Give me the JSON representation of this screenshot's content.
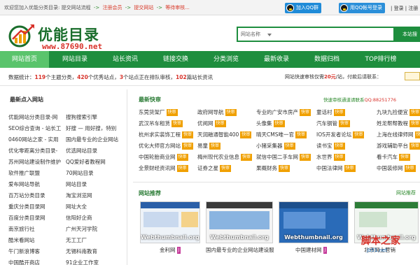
{
  "topbar": {
    "crumbs": [
      "欢迎您加入优能分类目录:",
      "提交网站流程",
      "注册会员",
      "提交网站",
      "等待审核..."
    ],
    "separator": "->",
    "qq_join": "加入QQ群",
    "qq_login": "用QQ帐号登录",
    "user_links": "| 登录 | 注册 |"
  },
  "logo": {
    "title": "优能目录",
    "url": "www.87690.net"
  },
  "search": {
    "category": "网站名称",
    "button": "本站搜"
  },
  "nav": {
    "items": [
      "网站首页",
      "网站目录",
      "站长资讯",
      "链接交换",
      "分类浏览",
      "最新收录",
      "数据归档",
      "TOP排行榜"
    ]
  },
  "stats": {
    "prefix": "数据统计：",
    "categories": "119",
    "categories_label": "个主题分类，",
    "sites": "420",
    "sites_label": "个优秀站点，",
    "pending": "3",
    "pending_label": "个站点正在排队审核，",
    "articles": "102",
    "articles_label": "篇站长资讯",
    "fast_prefix": "网站快速审核仅需",
    "fast_price": "20元",
    "fast_suffix": "/站，付款后请联系："
  },
  "hot": {
    "title": "最新点入网站",
    "col1": [
      "优能网站分类目录-网",
      "SEO综合查询 - 站长工",
      "0460网站之家 - 实用",
      "优化零距离分类目录-",
      "苏州网站建设制作维护",
      "软件推广联盟",
      "爱布网站导航",
      "百万站分类目录",
      "重庆分类目录网",
      "百度分类目录网",
      "南京旅行社",
      "酷米看网站",
      "午门新浪博客",
      "中国酷开商店"
    ],
    "col2": [
      "搜狗搜索引擎",
      "好搜 — 用好搜，特别",
      "国内最专业的企业网站",
      "优选网站目录",
      "QQ爱好者教程网",
      "70网站目录",
      "网站目录",
      "淘宝浏览网",
      "网址大全",
      "信阳好企商",
      "广州天河学院",
      "无工工厂",
      "无锡科南教育",
      "91企业工作室"
    ]
  },
  "news": {
    "title": "最新快审",
    "notice_prefix": "快速审核通道请联系",
    "notice_qq": "QQ:88251776",
    "tag": "快审",
    "col1": [
      "东莞货架厂",
      "武汉吊车租赁",
      "杭州求实装饰工程",
      "优化大师官方网站",
      "中国轮胎商业网",
      "全景财经资讯网"
    ],
    "col2": [
      "政府网导航",
      "优阅网",
      "天润融通智能400",
      "易童",
      "梅州现代农业信息",
      "证券之星"
    ],
    "col3": [
      "专业的广安市房产",
      "头像集",
      "晴天CMS唯一官",
      "小猪采集器",
      "就信中国二手车网",
      "果概财务"
    ],
    "col4": [
      "童话村",
      "汽车钢管",
      "IOS开发者论坛",
      "读书宝",
      "水世界",
      "中国法律网"
    ],
    "col5": [
      "九块九捡便宜",
      "姓龙帮帮教程",
      "上海在线律师网",
      "游戏辅助平台",
      "看卡汽车",
      "中国装修网"
    ]
  },
  "recommend": {
    "title": "网站推荐",
    "more": "网站推荐",
    "watermark": "Webthumbnail.org",
    "captions": [
      "金利网",
      "国内最专业的企业网站建设服",
      "中国建材网",
      "北京网上营销"
    ]
  },
  "corner": {
    "cn": "脚本之家",
    "en": "jb51.net"
  }
}
